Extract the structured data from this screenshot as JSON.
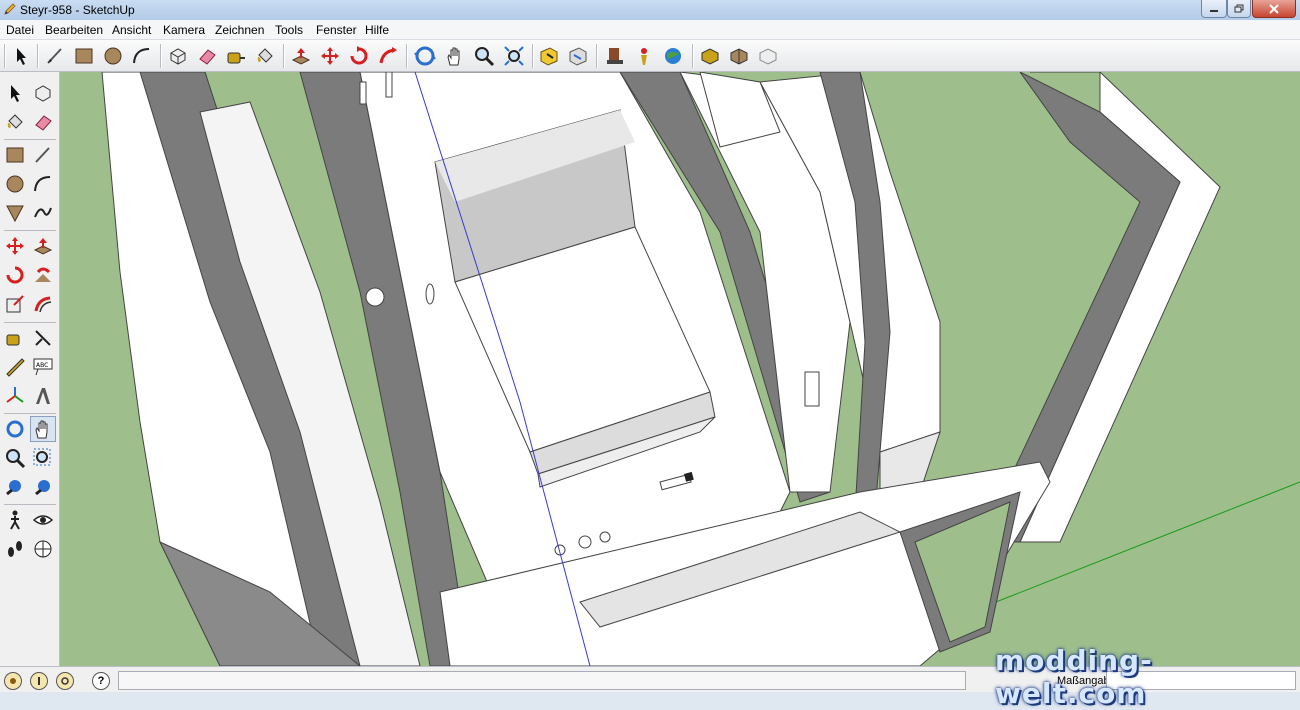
{
  "window": {
    "title": "Steyr-958 - SketchUp",
    "icon": "sketchup-pencil-icon"
  },
  "menu": [
    {
      "label": "Datei"
    },
    {
      "label": "Bearbeiten"
    },
    {
      "label": "Ansicht"
    },
    {
      "label": "Kamera"
    },
    {
      "label": "Zeichnen"
    },
    {
      "label": "Tools"
    },
    {
      "label": "Fenster"
    },
    {
      "label": "Hilfe"
    }
  ],
  "toolbar_icons": [
    "select-icon",
    "pencil-icon",
    "rectangle-icon",
    "circle-icon",
    "arc-icon",
    "make-component-icon",
    "eraser-icon",
    "tape-measure-icon",
    "paint-bucket-icon",
    "push-pull-icon",
    "move-icon",
    "rotate-icon",
    "follow-me-icon",
    "orbit-icon",
    "pan-icon",
    "zoom-icon",
    "zoom-extents-icon",
    "warehouse-get-models-icon",
    "share-model-icon",
    "component-icon",
    "extension-icon",
    "google-earth-icon",
    "photo-textures-icon",
    "toggle-terrain-icon",
    "section-icon"
  ],
  "left_tools": [
    "select-icon",
    "make-component-icon",
    "paint-bucket-icon",
    "eraser-icon",
    "rectangle-icon",
    "line-icon",
    "circle-icon",
    "arc-icon",
    "polygon-icon",
    "freehand-icon",
    "move-icon",
    "push-pull-icon",
    "rotate-icon",
    "follow-me-icon",
    "scale-icon",
    "offset-icon",
    "tape-measure-icon",
    "dimension-icon",
    "protractor-icon",
    "text-icon",
    "axes-icon",
    "3d-text-icon",
    "orbit-icon",
    "pan-icon",
    "zoom-icon",
    "zoom-window-icon",
    "zoom-extents-icon",
    "previous-view-icon",
    "walk-icon",
    "look-around-icon",
    "footprints-icon",
    "position-camera-icon"
  ],
  "status": {
    "icons": [
      "geo-location-icon",
      "credits-icon",
      "account-icon",
      "help-icon"
    ],
    "help_glyph": "?",
    "measure_label": "Maßangaben",
    "measure_value": ""
  },
  "watermark": "modding-welt.com",
  "colors": {
    "ground": "#9ebf8c",
    "model_face": "#ffffff",
    "model_shadow": "#7b7b7b",
    "blue_axis": "#3a3ad0",
    "green_axis": "#1a9a1a"
  }
}
